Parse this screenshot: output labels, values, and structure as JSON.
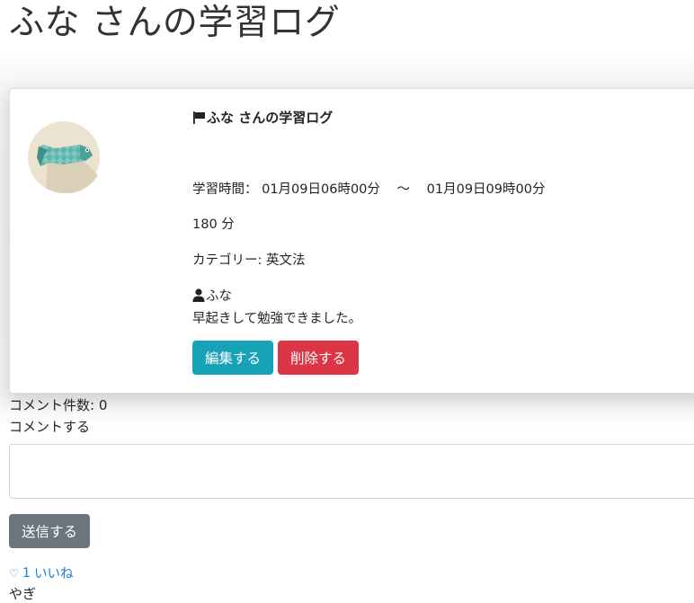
{
  "page": {
    "title": "ふな さんの学習ログ"
  },
  "card": {
    "title": "ふな さんの学習ログ",
    "time_label": "学習時間：",
    "time_start": "01月09日06時00分",
    "time_sep": "〜",
    "time_end": "01月09日09時00分",
    "minutes": "180 分",
    "category": "カテゴリー: 英文法",
    "user": "ふな",
    "note": "早起きして勉強できました。",
    "edit_label": "編集する",
    "delete_label": "削除する"
  },
  "comments": {
    "count_text": "コメント件数: 0",
    "form_label": "コメントする",
    "input_value": "",
    "send_label": "送信する"
  },
  "likes": {
    "icon": "heart-icon",
    "count": "1",
    "label": "いいね",
    "users": [
      "やぎ"
    ]
  },
  "colors": {
    "edit": "#17a2b8",
    "delete": "#dc3545",
    "send": "#6c757d",
    "link": "#1a7fd6"
  }
}
